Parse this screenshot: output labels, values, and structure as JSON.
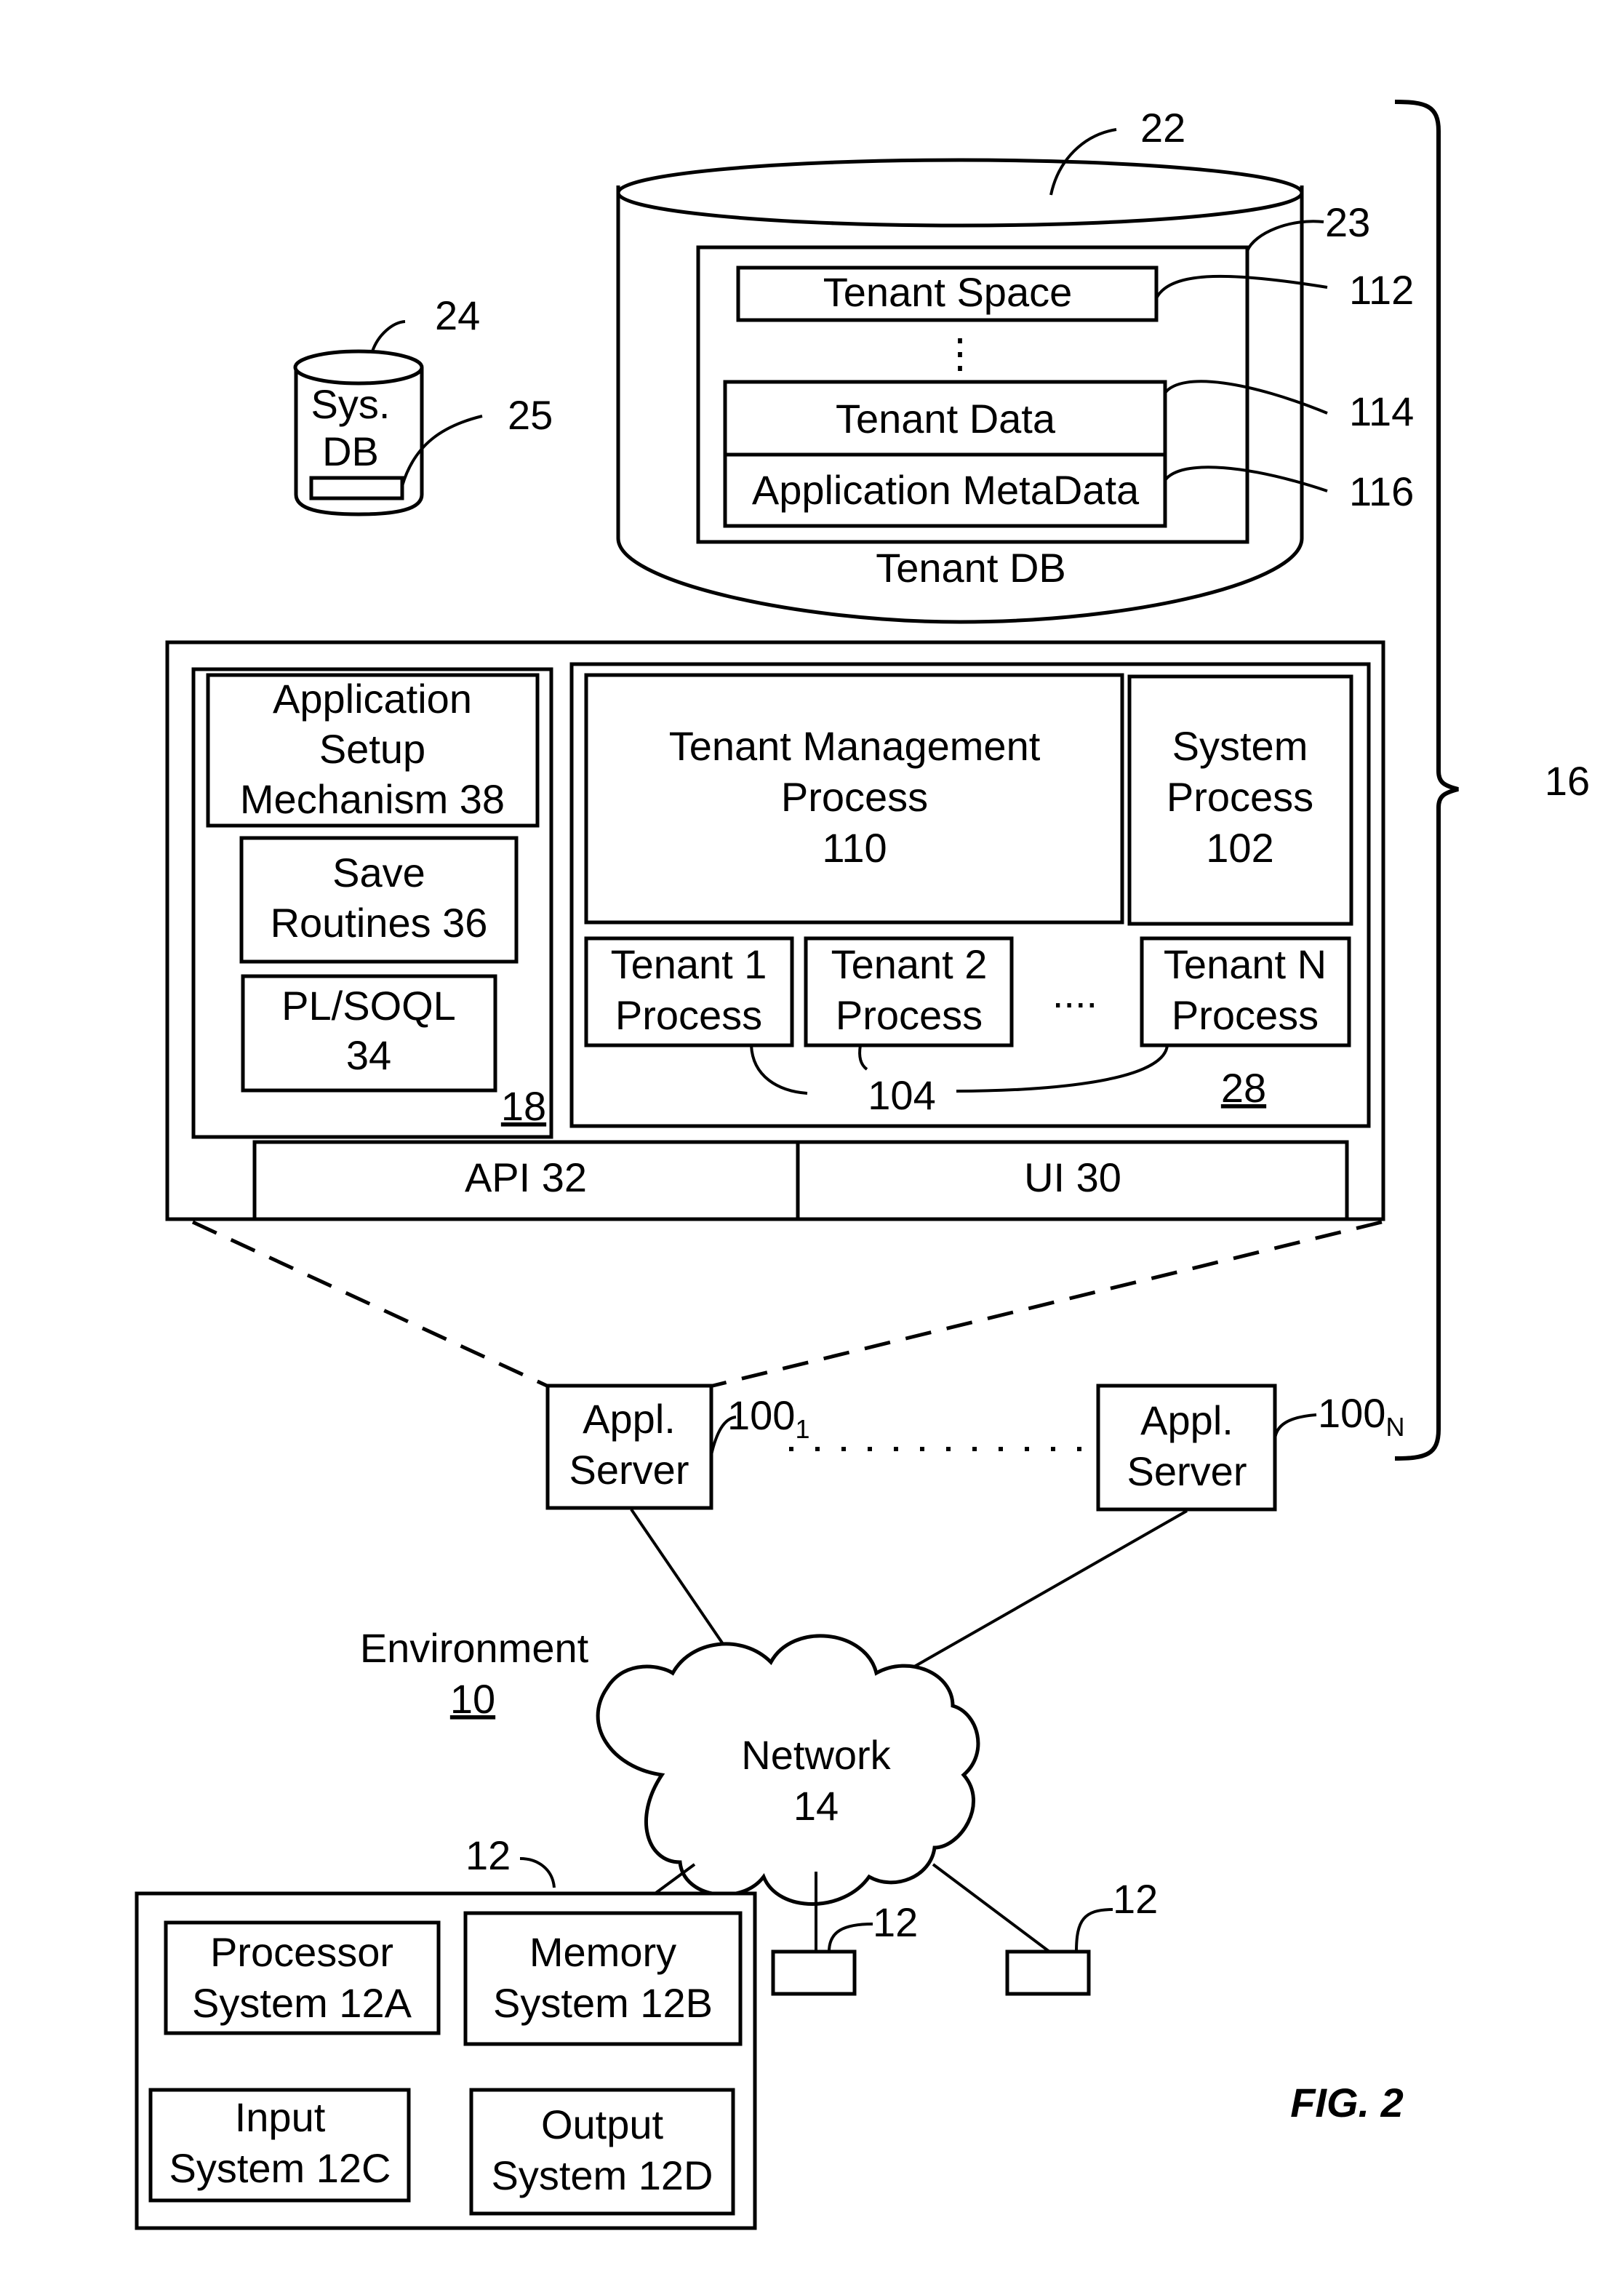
{
  "figure": {
    "title": "FIG. 2",
    "environment": {
      "label": "Environment",
      "ref": "10"
    },
    "system_ref": "16",
    "tenant_db": {
      "label": "Tenant DB",
      "ref": "22",
      "storage_ref": "23",
      "tenant_space": {
        "label": "Tenant Space",
        "ref": "112"
      },
      "ellipsis": "⋮",
      "tenant_data": {
        "label": "Tenant Data",
        "ref": "114"
      },
      "app_metadata": {
        "label": "Application MetaData",
        "ref": "116"
      }
    },
    "sys_db": {
      "line1": "Sys.",
      "line2": "DB",
      "ref": "24",
      "storage_ref": "25"
    },
    "server_block": {
      "left_panel": {
        "ref": "18",
        "app_setup": {
          "line1": "Application",
          "line2": "Setup",
          "line3": "Mechanism 38"
        },
        "save_routines": {
          "line1": "Save",
          "line2": "Routines 36"
        },
        "plsoql": {
          "line1": "PL/SOQL",
          "line2": "34"
        }
      },
      "right_panel": {
        "ref": "28",
        "tenant_mgmt": {
          "line1": "Tenant Management",
          "line2": "Process",
          "line3": "110"
        },
        "system_process": {
          "line1": "System",
          "line2": "Process",
          "line3": "102"
        },
        "tenant1": {
          "line1": "Tenant 1",
          "line2": "Process"
        },
        "tenant2": {
          "line1": "Tenant 2",
          "line2": "Process"
        },
        "tenant_ellipsis": "....",
        "tenantN": {
          "line1": "Tenant N",
          "line2": "Process"
        },
        "process_ref": "104"
      },
      "api": "API 32",
      "ui": "UI 30"
    },
    "app_servers": [
      {
        "line1": "Appl.",
        "line2": "Server",
        "ref": "100",
        "sub": "1"
      },
      {
        "line1": "Appl.",
        "line2": "Server",
        "ref": "100",
        "sub": "N"
      }
    ],
    "network": {
      "line1": "Network",
      "line2": "14"
    },
    "user_system": {
      "ref": "12",
      "processor": {
        "line1": "Processor",
        "line2": "System 12A"
      },
      "memory": {
        "line1": "Memory",
        "line2": "System 12B"
      },
      "input": {
        "line1": "Input",
        "line2": "System 12C"
      },
      "output": {
        "line1": "Output",
        "line2": "System 12D"
      }
    },
    "other_user_refs": [
      "12",
      "12"
    ]
  }
}
